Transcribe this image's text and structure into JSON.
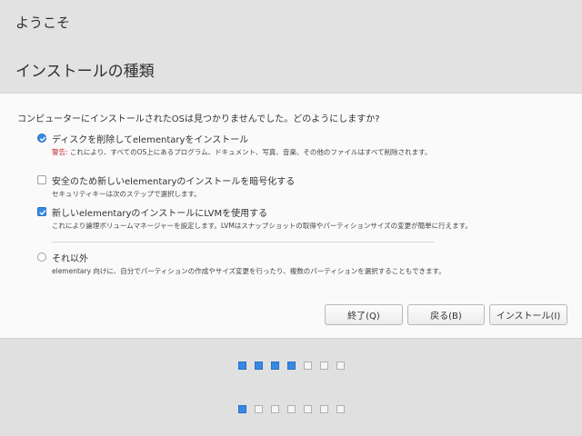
{
  "header": {
    "window_title": "ようこそ",
    "page_title": "インストールの種類"
  },
  "question": "コンピューターにインストールされたOSは見つかりませんでした。どのようにしますか?",
  "options": [
    {
      "type": "radio",
      "checked": true,
      "label": "ディスクを削除してelementaryをインストール",
      "warning_prefix": "警告:",
      "description": " これにより、すべてのOS上にあるプログラム、ドキュメント、写真、音楽、その他のファイルはすべて削除されます。"
    },
    {
      "type": "checkbox",
      "checked": false,
      "label": "安全のため新しいelementaryのインストールを暗号化する",
      "description": "セキュリティキーは次のステップで選択します。"
    },
    {
      "type": "checkbox",
      "checked": true,
      "label": "新しいelementaryのインストールにLVMを使用する",
      "description": "これにより論理ボリュームマネージャーを設定します。LVMはスナップショットの取得やパーティションサイズの変更が簡単に行えます。"
    },
    {
      "type": "radio",
      "checked": false,
      "label": "それ以外",
      "description": "elementary 向けに、自分でパーティションの作成やサイズ変更を行ったり、複数のパーティションを選択することもできます。"
    }
  ],
  "buttons": {
    "quit": "終了(Q)",
    "back": "戻る(B)",
    "install": "インストール(I)"
  },
  "progress_rows": [
    {
      "total": 7,
      "filled": 4
    },
    {
      "total": 7,
      "filled": 1
    }
  ],
  "colors": {
    "accent": "#3689e6",
    "warning": "#c6262e",
    "header_bg": "#e2e2e2",
    "panel_bg": "#fafafa"
  }
}
